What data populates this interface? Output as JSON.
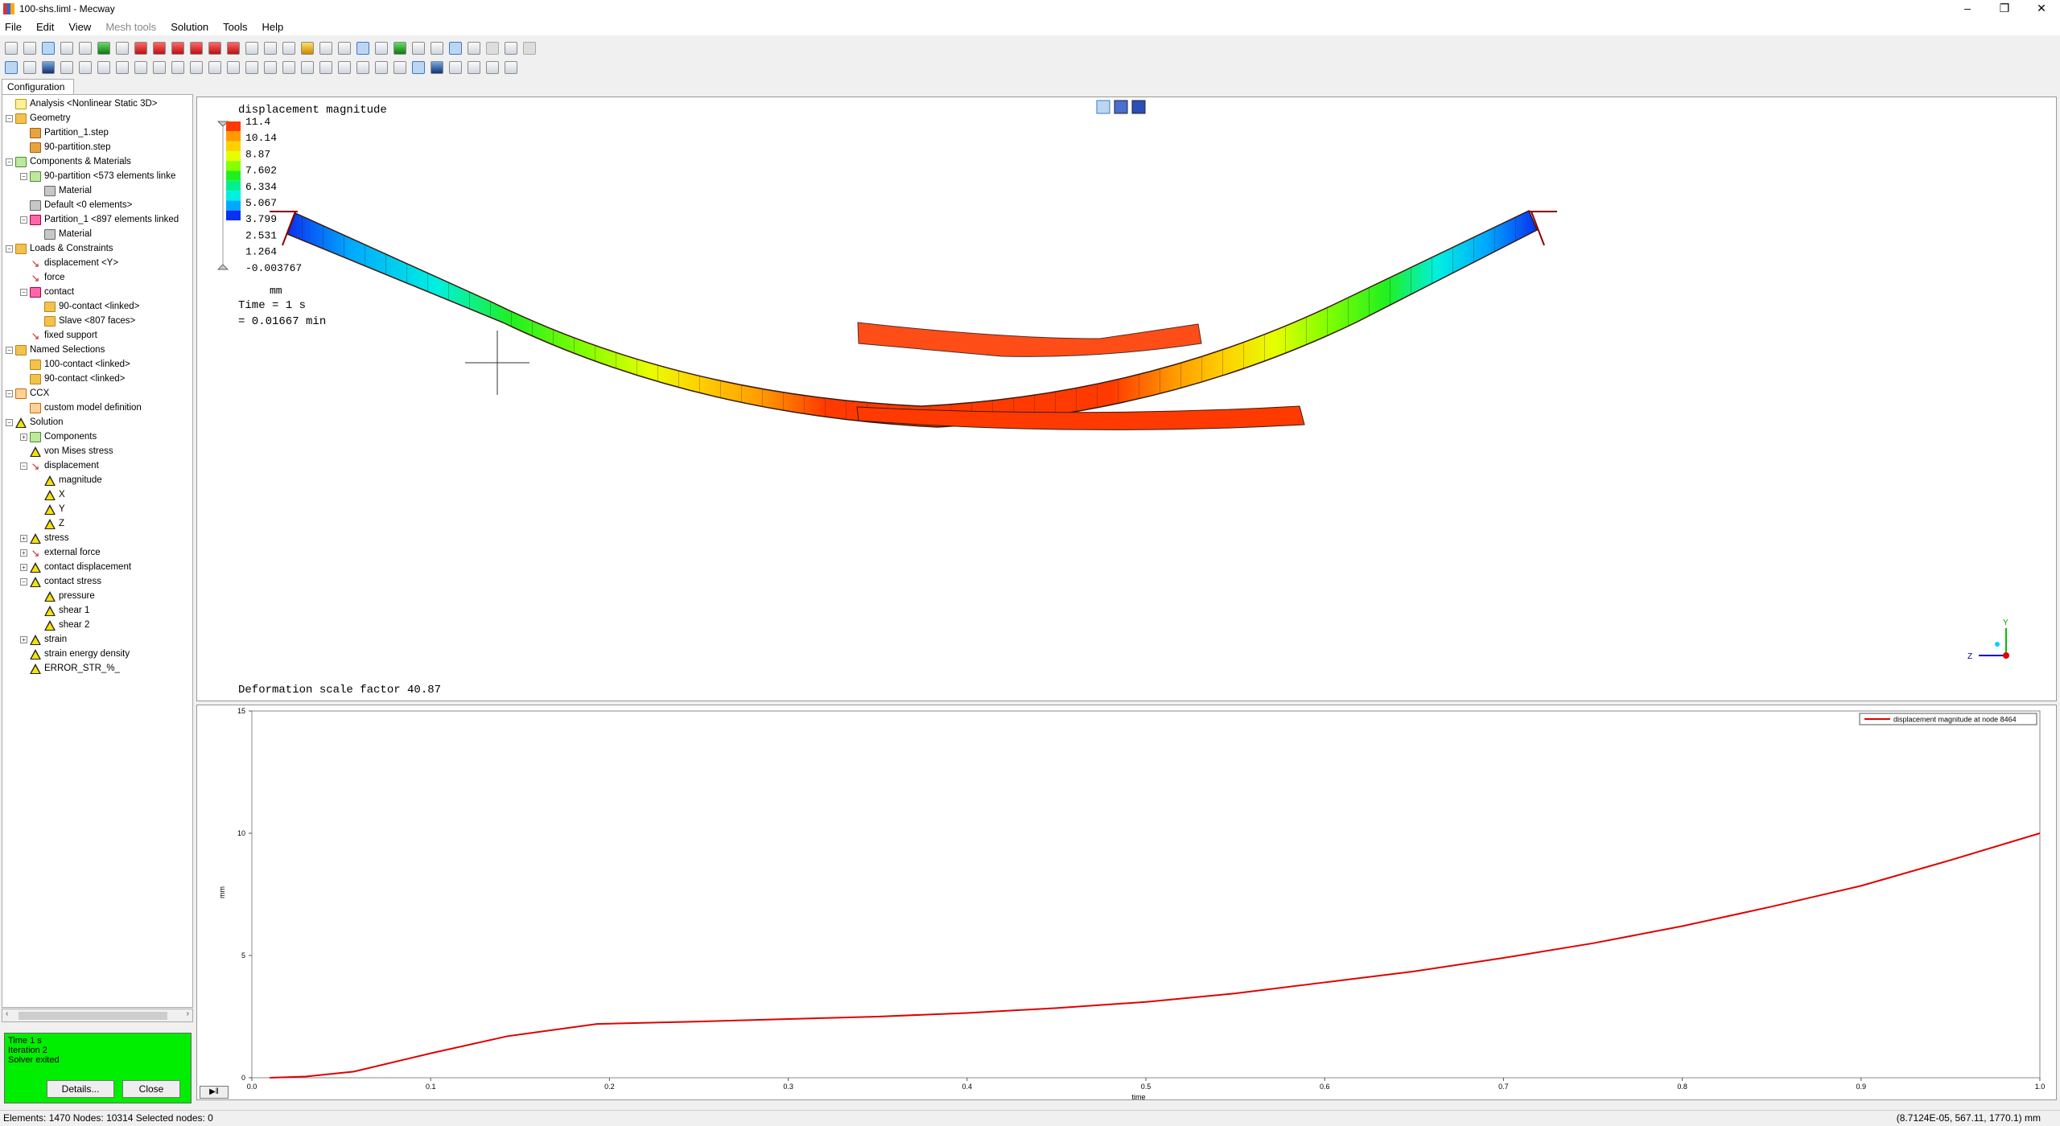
{
  "window": {
    "title": "100-shs.liml - Mecway"
  },
  "menu": [
    "File",
    "Edit",
    "View",
    "Mesh tools",
    "Solution",
    "Tools",
    "Help"
  ],
  "config_tab": "Configuration",
  "tree": [
    {
      "label": "Analysis <Nonlinear Static 3D>",
      "depth": 0,
      "icon": "analysis",
      "exp": ""
    },
    {
      "label": "Geometry",
      "depth": 0,
      "icon": "folder",
      "exp": "-"
    },
    {
      "label": "Partition_1.step",
      "depth": 1,
      "icon": "file",
      "exp": ""
    },
    {
      "label": "90-partition.step",
      "depth": 1,
      "icon": "file",
      "exp": ""
    },
    {
      "label": "Components & Materials",
      "depth": 0,
      "icon": "comp",
      "exp": "-"
    },
    {
      "label": "90-partition <573 elements linke",
      "depth": 1,
      "icon": "comp",
      "exp": "-"
    },
    {
      "label": "Material",
      "depth": 2,
      "icon": "mat",
      "exp": ""
    },
    {
      "label": "Default <0 elements>",
      "depth": 1,
      "icon": "mat",
      "exp": ""
    },
    {
      "label": "Partition_1 <897 elements linked",
      "depth": 1,
      "icon": "load",
      "exp": "-"
    },
    {
      "label": "Material",
      "depth": 2,
      "icon": "mat",
      "exp": ""
    },
    {
      "label": "Loads & Constraints",
      "depth": 0,
      "icon": "folder",
      "exp": "-"
    },
    {
      "label": "displacement <Y>",
      "depth": 1,
      "icon": "arrow",
      "exp": ""
    },
    {
      "label": "force",
      "depth": 1,
      "icon": "arrow",
      "exp": ""
    },
    {
      "label": "contact",
      "depth": 1,
      "icon": "load",
      "exp": "-"
    },
    {
      "label": "90-contact <linked>",
      "depth": 2,
      "icon": "folder",
      "exp": ""
    },
    {
      "label": "Slave <807 faces>",
      "depth": 2,
      "icon": "folder",
      "exp": ""
    },
    {
      "label": "fixed support",
      "depth": 1,
      "icon": "arrow",
      "exp": ""
    },
    {
      "label": "Named Selections",
      "depth": 0,
      "icon": "folder",
      "exp": "-"
    },
    {
      "label": "100-contact <linked>",
      "depth": 1,
      "icon": "folder",
      "exp": ""
    },
    {
      "label": "90-contact <linked>",
      "depth": 1,
      "icon": "folder",
      "exp": ""
    },
    {
      "label": "CCX",
      "depth": 0,
      "icon": "ccx",
      "exp": "-"
    },
    {
      "label": "custom model definition",
      "depth": 1,
      "icon": "ccx",
      "exp": ""
    },
    {
      "label": "Solution",
      "depth": 0,
      "icon": "tri",
      "exp": "-"
    },
    {
      "label": "Components",
      "depth": 1,
      "icon": "comp",
      "exp": "+"
    },
    {
      "label": "von Mises stress",
      "depth": 1,
      "icon": "tri",
      "exp": ""
    },
    {
      "label": "displacement",
      "depth": 1,
      "icon": "arrow",
      "exp": "-"
    },
    {
      "label": "magnitude",
      "depth": 2,
      "icon": "tri",
      "exp": ""
    },
    {
      "label": "X",
      "depth": 2,
      "icon": "tri",
      "exp": ""
    },
    {
      "label": "Y",
      "depth": 2,
      "icon": "tri",
      "exp": ""
    },
    {
      "label": "Z",
      "depth": 2,
      "icon": "tri",
      "exp": ""
    },
    {
      "label": "stress",
      "depth": 1,
      "icon": "tri",
      "exp": "+"
    },
    {
      "label": "external force",
      "depth": 1,
      "icon": "arrow",
      "exp": "+"
    },
    {
      "label": "contact displacement",
      "depth": 1,
      "icon": "tri",
      "exp": "+"
    },
    {
      "label": "contact stress",
      "depth": 1,
      "icon": "tri",
      "exp": "-"
    },
    {
      "label": "pressure",
      "depth": 2,
      "icon": "tri",
      "exp": ""
    },
    {
      "label": "shear 1",
      "depth": 2,
      "icon": "tri",
      "exp": ""
    },
    {
      "label": "shear 2",
      "depth": 2,
      "icon": "tri",
      "exp": ""
    },
    {
      "label": "strain",
      "depth": 1,
      "icon": "tri",
      "exp": "+"
    },
    {
      "label": "strain energy density",
      "depth": 1,
      "icon": "tri",
      "exp": ""
    },
    {
      "label": "ERROR_STR_%_",
      "depth": 1,
      "icon": "tri",
      "exp": ""
    }
  ],
  "solver": {
    "lines": [
      "Time 1 s",
      "Iteration 2",
      "Solver exited"
    ],
    "details_label": "Details...",
    "close_label": "Close",
    "color": "#00ee00"
  },
  "view3d": {
    "legend_title": "displacement magnitude",
    "legend_values": [
      "11.4",
      "10.14",
      "8.87",
      "7.602",
      "6.334",
      "5.067",
      "3.799",
      "2.531",
      "1.264",
      "-0.003767"
    ],
    "legend_colors": [
      "#ff3a00",
      "#ff9a00",
      "#ffd000",
      "#e6ff00",
      "#86ff00",
      "#20f020",
      "#00f090",
      "#00f0e0",
      "#00a8ff",
      "#0a30f0"
    ],
    "unit": "mm",
    "time_line1": "Time = 1 s",
    "time_line2": "= 0.01667 min",
    "deform_text": "Deformation scale factor 40.87",
    "axes": {
      "y": "Y",
      "z": "Z"
    }
  },
  "chart_data": {
    "type": "line",
    "legend": "displacement magnitude at node 8464",
    "xlabel": "time",
    "ylabel": "mm",
    "xlim": [
      0,
      1
    ],
    "ylim": [
      0,
      15
    ],
    "xticks": [
      "0.0",
      "0.1",
      "0.2",
      "0.3",
      "0.4",
      "0.5",
      "0.6",
      "0.7",
      "0.8",
      "0.9",
      "1.0"
    ],
    "yticks": [
      "0",
      "5",
      "10",
      "15"
    ],
    "series": [
      {
        "name": "displacement magnitude at node 8464",
        "color": "#e00000",
        "x": [
          0.01,
          0.03,
          0.057,
          0.1,
          0.143,
          0.193,
          0.25,
          0.3,
          0.35,
          0.4,
          0.45,
          0.5,
          0.55,
          0.6,
          0.65,
          0.7,
          0.75,
          0.8,
          0.85,
          0.9,
          0.95,
          1.0
        ],
        "y": [
          0,
          0.05,
          0.25,
          1.0,
          1.7,
          2.2,
          2.3,
          2.4,
          2.5,
          2.65,
          2.85,
          3.1,
          3.45,
          3.9,
          4.35,
          4.9,
          5.5,
          6.2,
          7.0,
          7.85,
          8.9,
          10.0
        ]
      }
    ]
  },
  "play_label": "▶‖",
  "status": {
    "left": "Elements: 1470   Nodes: 10314   Selected nodes: 0",
    "right": "(8.7124E-05, 567.11, 1770.1) mm"
  }
}
